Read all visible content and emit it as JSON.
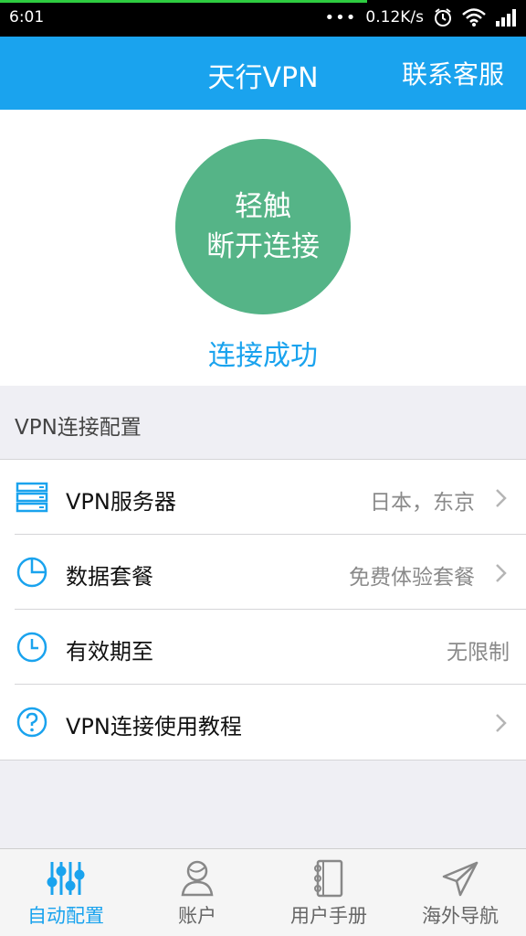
{
  "status_bar": {
    "time": "6:01",
    "network_speed": "0.12K/s"
  },
  "header": {
    "title": "天行VPN",
    "contact_label": "联系客服"
  },
  "connection": {
    "button_line1": "轻触",
    "button_line2": "断开连接",
    "status": "连接成功"
  },
  "config": {
    "section_title": "VPN连接配置",
    "rows": [
      {
        "icon": "server-icon",
        "label": "VPN服务器",
        "value": "日本，东京"
      },
      {
        "icon": "pie-chart-icon",
        "label": "数据套餐",
        "value": "免费体验套餐"
      },
      {
        "icon": "clock-icon",
        "label": "有效期至",
        "value": "无限制"
      },
      {
        "icon": "question-icon",
        "label": "VPN连接使用教程",
        "value": ""
      }
    ]
  },
  "tabs": [
    {
      "icon": "sliders-icon",
      "label": "自动配置",
      "active": true
    },
    {
      "icon": "user-icon",
      "label": "账户",
      "active": false
    },
    {
      "icon": "notebook-icon",
      "label": "用户手册",
      "active": false
    },
    {
      "icon": "paper-plane-icon",
      "label": "海外导航",
      "active": false
    }
  ],
  "colors": {
    "accent": "#1aa3ee",
    "connect_button": "#55b487",
    "background": "#efeff4"
  }
}
